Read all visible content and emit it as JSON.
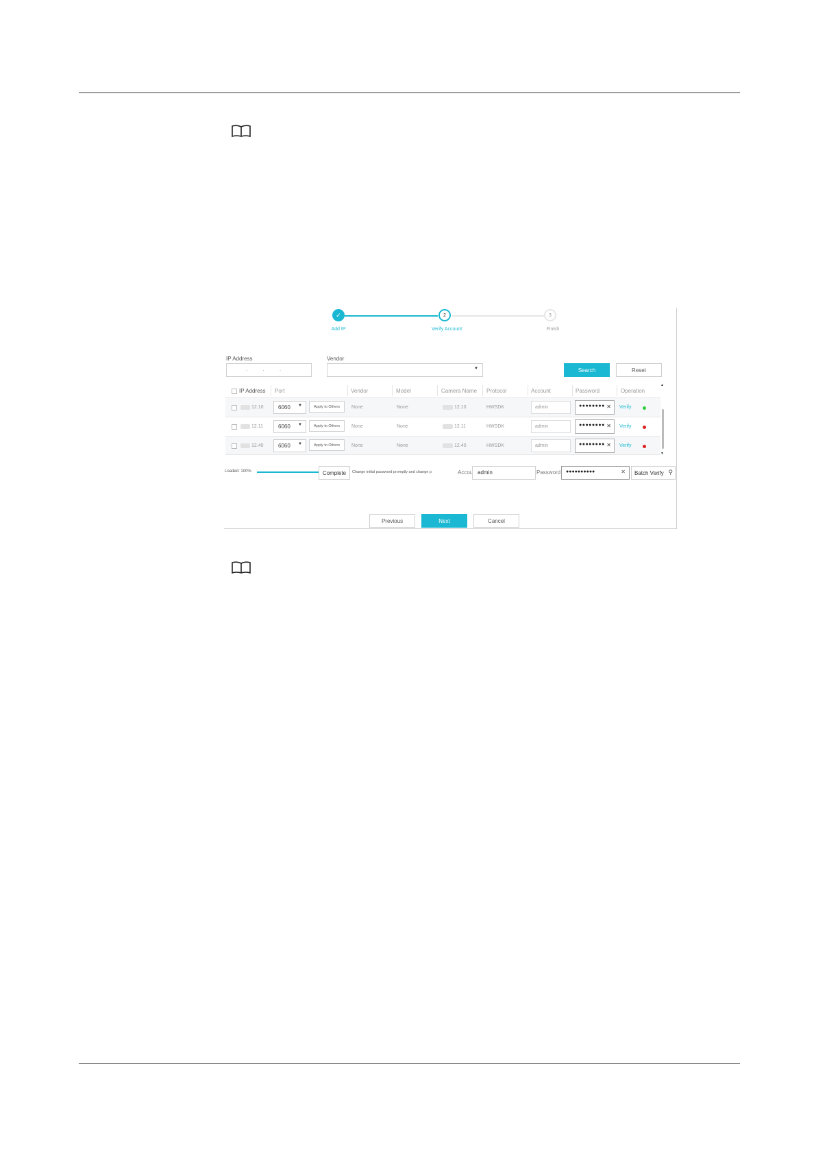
{
  "steps": [
    {
      "label": "Add IP",
      "number": "✓",
      "state": "done"
    },
    {
      "label": "Verify Account",
      "number": "2",
      "state": "active"
    },
    {
      "label": "Finish",
      "number": "3",
      "state": "pending"
    }
  ],
  "filters": {
    "ip_label": "IP Address",
    "ip_dots": ".          .          .",
    "vendor_label": "Vendor",
    "search_label": "Search",
    "reset_label": "Reset"
  },
  "table": {
    "columns": [
      "IP Address",
      "Port",
      "Vendor",
      "Model",
      "Camera Name",
      "Protocol",
      "Account",
      "Password",
      "Operation"
    ],
    "rows": [
      {
        "ip_suffix": "12.10",
        "port": "6060",
        "apply": "Apply to Others",
        "vendor": "None",
        "model": "None",
        "camera_suffix": "12.10",
        "protocol": "HWSDK",
        "account": "admin",
        "password": "●●●●●●●●",
        "operation": "Verify",
        "status_color": "#2ecc40"
      },
      {
        "ip_suffix": "12.11",
        "port": "6060",
        "apply": "Apply to Others",
        "vendor": "None",
        "model": "None",
        "camera_suffix": "12.11",
        "protocol": "HWSDK",
        "account": "admin",
        "password": "●●●●●●●●",
        "operation": "Verify",
        "status_color": "#e02020"
      },
      {
        "ip_suffix": "12.40",
        "port": "6060",
        "apply": "Apply to Others",
        "vendor": "None",
        "model": "None",
        "camera_suffix": "12.40",
        "protocol": "HWSDK",
        "account": "admin",
        "password": "●●●●●●●●",
        "operation": "Verify",
        "status_color": "#e02020"
      }
    ]
  },
  "footer": {
    "loaded_text": "Loaded: 100%",
    "progress": 1.0,
    "complete_label": "Complete",
    "change_text": "Change initial password promptly and change p",
    "account_label": "Account",
    "account_value": "admin",
    "password_label": "Password",
    "password_value": "●●●●●●●●●●",
    "batch_verify_label": "Batch Verify"
  },
  "nav": {
    "previous": "Previous",
    "next": "Next",
    "cancel": "Cancel"
  },
  "colors": {
    "accent": "#1ab8d2",
    "ok": "#2ecc40",
    "error": "#e02020"
  }
}
